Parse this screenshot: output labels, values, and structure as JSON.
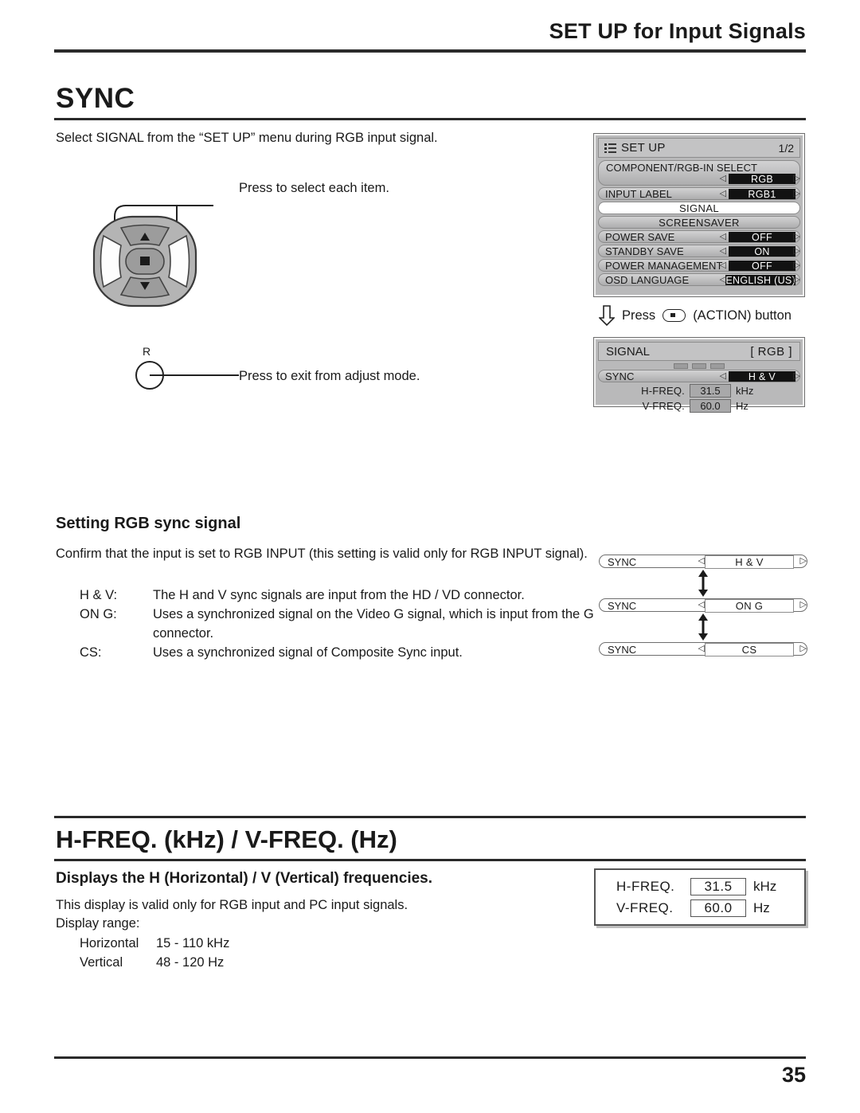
{
  "header": {
    "title": "SET UP for Input Signals"
  },
  "section_sync": {
    "title": "SYNC",
    "intro": "Select SIGNAL from the “SET UP” menu during RGB input signal.",
    "callout_select": "Press to select each item.",
    "callout_exit": "Press to exit from adjust mode.",
    "remote_label_r": "R",
    "press_action": "Press       (ACTION) button"
  },
  "osd_setup": {
    "icon": "menu-list-icon",
    "title": "SET UP",
    "page": "1/2",
    "rows": [
      {
        "name": "COMPONENT/RGB-IN  SELECT",
        "value": "RGB",
        "type": "tall",
        "arrow_left": "◁",
        "arrow_right": "▷"
      },
      {
        "name": "INPUT LABEL",
        "value": "RGB1",
        "type": "value",
        "arrow_left": "◁",
        "arrow_right": "▷"
      },
      {
        "name": "SIGNAL",
        "value": "",
        "type": "white"
      },
      {
        "name": "SCREENSAVER",
        "value": "",
        "type": "center"
      },
      {
        "name": "POWER SAVE",
        "value": "OFF",
        "type": "value",
        "arrow_left": "◁",
        "arrow_right": "▷"
      },
      {
        "name": "STANDBY SAVE",
        "value": "ON",
        "type": "value",
        "arrow_left": "◁",
        "arrow_right": "▷"
      },
      {
        "name": "POWER MANAGEMENT",
        "value": "OFF",
        "type": "value",
        "arrow_left": "◁",
        "arrow_right": "▷"
      },
      {
        "name": "OSD  LANGUAGE",
        "value": "ENGLISH (US)",
        "type": "value",
        "arrow_left": "◁",
        "arrow_right": "▷"
      }
    ]
  },
  "osd_signal": {
    "title": "SIGNAL",
    "tag": "[ RGB ]",
    "sync_label": "SYNC",
    "sync_value": "H & V",
    "arrow_left": "◁",
    "arrow_right": "▷",
    "hfreq_label": "H-FREQ.",
    "hfreq_value": "31.5",
    "hfreq_unit": "kHz",
    "vfreq_label": "V-FREQ.",
    "vfreq_value": "60.0",
    "vfreq_unit": "Hz"
  },
  "section_rgb": {
    "heading": "Setting RGB sync signal",
    "paragraph": "Confirm that the input is set to RGB INPUT (this setting is valid only for RGB INPUT signal).",
    "definitions": [
      {
        "term": "H & V:",
        "desc": "The H and V sync signals are input from the HD / VD connector."
      },
      {
        "term": "ON G:",
        "desc": "Uses a synchronized signal on the Video G signal, which is input from the G connector."
      },
      {
        "term": "CS:",
        "desc": "Uses a synchronized signal of Composite Sync input."
      }
    ],
    "sync_options": [
      {
        "label": "SYNC",
        "value": "H & V",
        "arrow_left": "◁",
        "arrow_right": "▷"
      },
      {
        "label": "SYNC",
        "value": "ON  G",
        "arrow_left": "◁",
        "arrow_right": "▷"
      },
      {
        "label": "SYNC",
        "value": "CS",
        "arrow_left": "◁",
        "arrow_right": "▷"
      }
    ],
    "updown_arrow": "⇕"
  },
  "section_freq": {
    "title": "H-FREQ. (kHz) / V-FREQ. (Hz)",
    "subheading": "Displays the H (Horizontal) / V (Vertical) frequencies.",
    "paragraph": "This display is valid only for RGB input and PC input signals.",
    "range_label": "Display range:",
    "ranges": [
      {
        "name": "Horizontal",
        "value": "15 - 110 kHz"
      },
      {
        "name": "Vertical",
        "value": "48 - 120 Hz"
      }
    ],
    "panel": {
      "hfreq_label": "H-FREQ.",
      "hfreq_value": "31.5",
      "hfreq_unit": "kHz",
      "vfreq_label": "V-FREQ.",
      "vfreq_value": "60.0",
      "vfreq_unit": "Hz"
    }
  },
  "footer": {
    "page_number": "35"
  }
}
